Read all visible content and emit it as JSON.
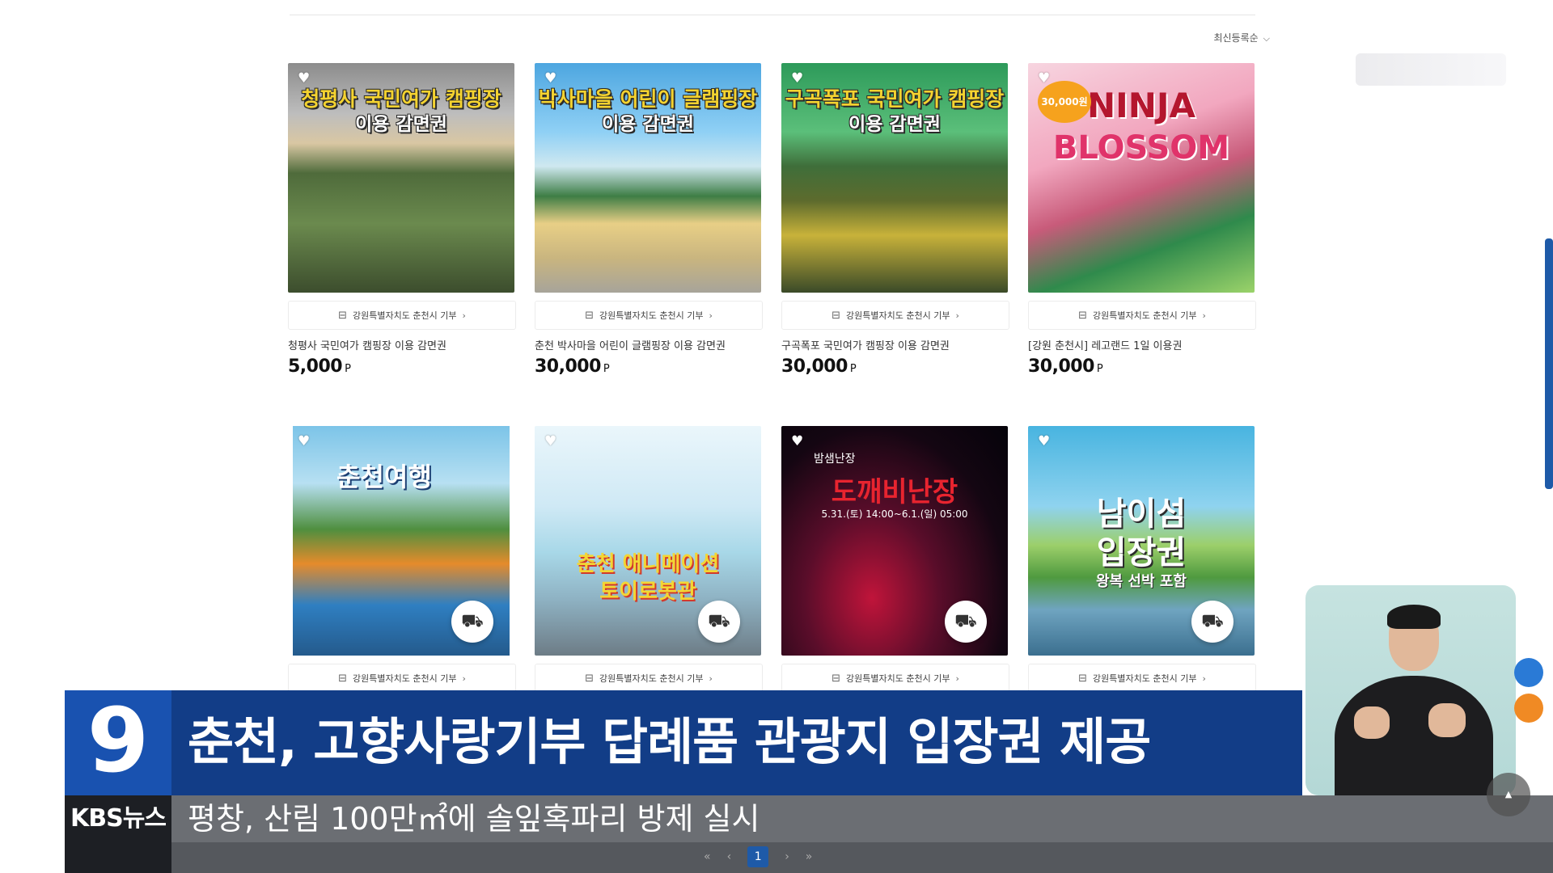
{
  "sort": {
    "label": "최신등록순"
  },
  "products": [
    {
      "donor": "강원특별자치도 춘천시 기부",
      "name": "청평사 국민여가 캠핑장 이용 감면권",
      "price": "5,000",
      "unit": "P",
      "banner_title": "청평사 국민여가 캠핑장",
      "banner_sub": "이용 감면권"
    },
    {
      "donor": "강원특별자치도 춘천시 기부",
      "name": "춘천 박사마을 어린이 글램핑장 이용 감면권",
      "price": "30,000",
      "unit": "P",
      "banner_title": "박사마을 어린이 글램핑장",
      "banner_sub": "이용 감면권"
    },
    {
      "donor": "강원특별자치도 춘천시 기부",
      "name": "구곡폭포 국민여가 캠핑장 이용 감면권",
      "price": "30,000",
      "unit": "P",
      "banner_title": "구곡폭포 국민여가 캠핑장",
      "banner_sub": "이용 감면권"
    },
    {
      "donor": "강원특별자치도 춘천시 기부",
      "name": "[강원 춘천시] 레고랜드 1일 이용권",
      "price": "30,000",
      "unit": "P",
      "banner_title": "NINJA",
      "banner_sub": "BLOSSOM",
      "badge": "30,000원"
    },
    {
      "donor": "강원특별자치도 춘천시 기부",
      "banner_title": "춘천여행"
    },
    {
      "donor": "강원특별자치도 춘천시 기부",
      "banner_title": "춘천 애니메이션",
      "banner_sub": "토이로봇관"
    },
    {
      "donor": "강원특별자치도 춘천시 기부",
      "banner_title": "도깨비난장",
      "banner_pre": "밤샘난장",
      "banner_sub": "5.31.(토) 14:00~6.1.(일) 05:00"
    },
    {
      "donor": "강원특별자치도 춘천시 기부",
      "banner_title": "남이섬",
      "banner_sub": "입장권",
      "banner_note": "왕복 선박 포함"
    }
  ],
  "news": {
    "channel_number": "9",
    "headline": "춘천, 고향사랑기부 답례품 관광지 입장권 제공",
    "ticker_logo": "KBS뉴스",
    "ticker": "평창, 산림 100만㎡에 솔잎혹파리 방제 실시"
  },
  "pagination": {
    "current": "1"
  },
  "icons": {
    "heart": "heart-icon",
    "cart": "cart-icon",
    "bag": "shopping-bag-icon",
    "chevron": "chevron-down-icon"
  },
  "colors": {
    "chyron": "#123d87",
    "logo_bg": "#1952b0",
    "ticker": "#6b6e73",
    "accent": "#1e5aa8"
  }
}
